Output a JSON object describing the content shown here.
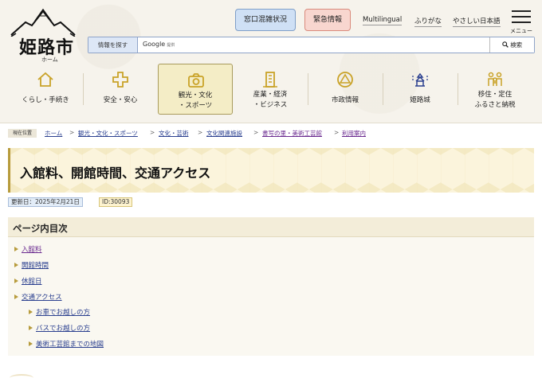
{
  "header": {
    "logo_text": "姫路市",
    "logo_sub": "ホーム",
    "btn_madoguchi": "窓口混雑状況",
    "btn_kinkyu": "緊急情報",
    "links": [
      "Multilingual",
      "ふりがな",
      "やさしい日本語"
    ],
    "menu_label": "メニュー",
    "search": {
      "label": "情報を探す",
      "google": "Google",
      "google_sub": "提供",
      "button": "検索"
    }
  },
  "nav": [
    {
      "label": [
        "くらし・手続き"
      ],
      "icon": "house-icon"
    },
    {
      "label": [
        "安全・安心"
      ],
      "icon": "cross-icon"
    },
    {
      "label": [
        "観光・文化",
        "・スポーツ"
      ],
      "icon": "camera-icon",
      "active": true
    },
    {
      "label": [
        "産業・経済",
        "・ビジネス"
      ],
      "icon": "building-icon"
    },
    {
      "label": [
        "市政情報"
      ],
      "icon": "emblem-icon"
    },
    {
      "label": [
        "姫路城"
      ],
      "icon": "castle-icon"
    },
    {
      "label": [
        "移住・定住",
        "ふるさと納税"
      ],
      "icon": "family-icon"
    }
  ],
  "breadcrumb": {
    "current_label": "現在位置",
    "items": [
      "ホーム",
      "観光・文化・スポーツ",
      "文化・芸術",
      "文化関連施設",
      "書写の里・美術工芸館",
      "利用案内"
    ],
    "separator": ">"
  },
  "page": {
    "title": "入館料、開館時間、交通アクセス",
    "updated": "更新日：2025年2月21日",
    "id": "ID:30093"
  },
  "toc": {
    "title": "ページ内目次",
    "items": [
      {
        "label": "入館料",
        "level": 1
      },
      {
        "label": "開館時間",
        "level": 1
      },
      {
        "label": "休館日",
        "level": 1
      },
      {
        "label": "交通アクセス",
        "level": 1
      },
      {
        "label": "お車でお越しの方",
        "level": 2
      },
      {
        "label": "バスでお越しの方",
        "level": 2
      },
      {
        "label": "美術工芸館までの地図",
        "level": 2
      }
    ]
  },
  "colors": {
    "accent": "#b79b3c",
    "link": "#2a3f8f",
    "nav_active_bg": "#f4edc6",
    "icon_gold": "#c9a227"
  }
}
